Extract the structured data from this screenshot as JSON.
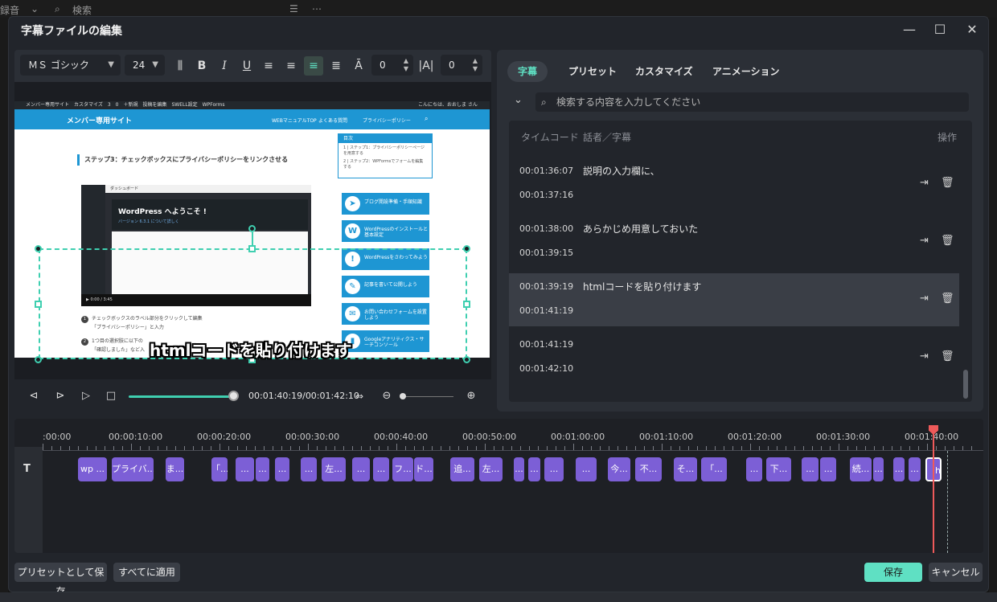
{
  "background": {
    "top_left": "録音",
    "top_search": "検索"
  },
  "dialog": {
    "title": "字幕ファイルの編集"
  },
  "toolbar": {
    "font": "ＭＳ ゴシック",
    "size": "24",
    "spacing_value": "0",
    "line_height_value": "0"
  },
  "preview": {
    "wp_bar": "メンバー専用サイト　カスタマイズ　3　0　＋新規　投稿を編集　SWELL設定　WPForms",
    "wp_user": "こんにちは、おおしま さん",
    "site_title": "メンバー専用サイト",
    "nav": [
      "WEBマニュアルTOP",
      "よくある質問",
      "プライバシーポリシー"
    ],
    "heading": "ステップ3：チェックボックスにプライバシーポリシーをリンクさせる",
    "dashboard": "ダッシュボード",
    "welcome": "WordPress へようこそ !",
    "welcome_sub": "バージョン 6.3.1 について詳しく",
    "video_time": "0:00 / 3:45",
    "step1": "チェックボックスのラベル部分をクリックして編集",
    "step1b": "「プライバシーポリシー」と入力",
    "step2": "1つ目の選択肢に以下の",
    "step2b": "「確認しました」など入",
    "toc_title": "目次",
    "toc_items": [
      "1 | ステップ1：プライバシーポリシーページを用意する",
      "2 | ステップ2：WPFormsでフォームを編集する"
    ],
    "side_buttons": [
      "ブログ開設準備・手順知識",
      "WordPressのインストールと基本設定",
      "WordPressをさわってみよう",
      "記事を書いて公開しよう",
      "お問い合わせフォームを設置しよう",
      "Googleアナリティクス・サーチコンソール"
    ],
    "subtitle_text": "htmlコードを貼り付けます"
  },
  "playback": {
    "timecode": "00:01:40:19/00:01:42:10",
    "progress_fraction": 0.94
  },
  "right_panel": {
    "tabs": [
      "字幕",
      "プリセット",
      "カスタマイズ",
      "アニメーション"
    ],
    "search_placeholder": "検索する内容を入力してください",
    "col_timecode": "タイムコード",
    "col_speaker": "話者／字幕",
    "col_action": "操作",
    "rows": [
      {
        "start": "00:01:36:07",
        "end": "00:01:37:16",
        "text": "説明の入力欄に、"
      },
      {
        "start": "00:01:38:00",
        "end": "00:01:39:15",
        "text": "あらかじめ用意しておいた"
      },
      {
        "start": "00:01:39:19",
        "end": "00:01:41:19",
        "text": "htmlコードを貼り付けます"
      },
      {
        "start": "00:01:41:19",
        "end": "00:01:42:10",
        "text": ""
      }
    ]
  },
  "timeline": {
    "labels": [
      ":00:00",
      "00:00:10:00",
      "00:00:20:00",
      "00:00:30:00",
      "00:00:40:00",
      "00:00:50:00",
      "00:01:00:00",
      "00:01:10:00",
      "00:01:20:00",
      "00:01:30:00",
      "00:01:40:00"
    ],
    "clips": [
      "wp ...",
      "プライバ...",
      "ま...",
      "「...",
      "...",
      "...",
      "...",
      "...",
      "左...",
      "...",
      "...",
      "フ...",
      "ド...",
      "追...",
      "左...",
      "...",
      "...",
      "...",
      "...",
      "今...",
      "不...",
      "そ...",
      "「...",
      "...",
      "下...",
      "...",
      "...",
      "続...",
      "...",
      "...",
      "...",
      "h..."
    ]
  },
  "footer": {
    "save_preset": "プリセットとして保存",
    "apply_all": "すべてに適用",
    "save": "保存",
    "cancel": "キャンセル"
  },
  "colors": {
    "accent": "#5fe0c3",
    "clip": "#7c5fd6",
    "playhead": "#ee5a5a",
    "site_blue": "#1e96d3"
  }
}
